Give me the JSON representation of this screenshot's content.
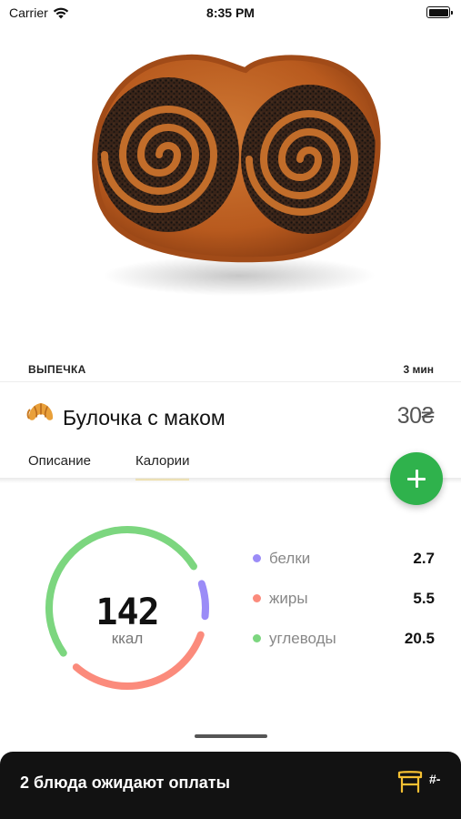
{
  "status_bar": {
    "carrier": "Carrier",
    "time": "8:35 PM"
  },
  "product": {
    "category": "ВЫПЕЧКА",
    "cook_time": "3 мин",
    "name": "Булочка с маком",
    "price": "30₴",
    "image": "poppy-seed-bun"
  },
  "tabs": [
    {
      "label": "Описание",
      "active": false
    },
    {
      "label": "Калории",
      "active": true
    }
  ],
  "nutrition": {
    "calories": "142",
    "unit": "ккал",
    "macros": [
      {
        "label": "белки",
        "value": "2.7",
        "color": "#9b8cf7"
      },
      {
        "label": "жиры",
        "value": "5.5",
        "color": "#fb8b7c"
      },
      {
        "label": "углеводы",
        "value": "20.5",
        "color": "#7cd67f"
      }
    ]
  },
  "bottom_bar": {
    "pending_text": "2 блюда ожидают оплаты",
    "table_number": "#-"
  },
  "colors": {
    "accent_green": "#2fb24c",
    "tab_underline": "#f5d047",
    "bottom_bar": "#121212"
  }
}
